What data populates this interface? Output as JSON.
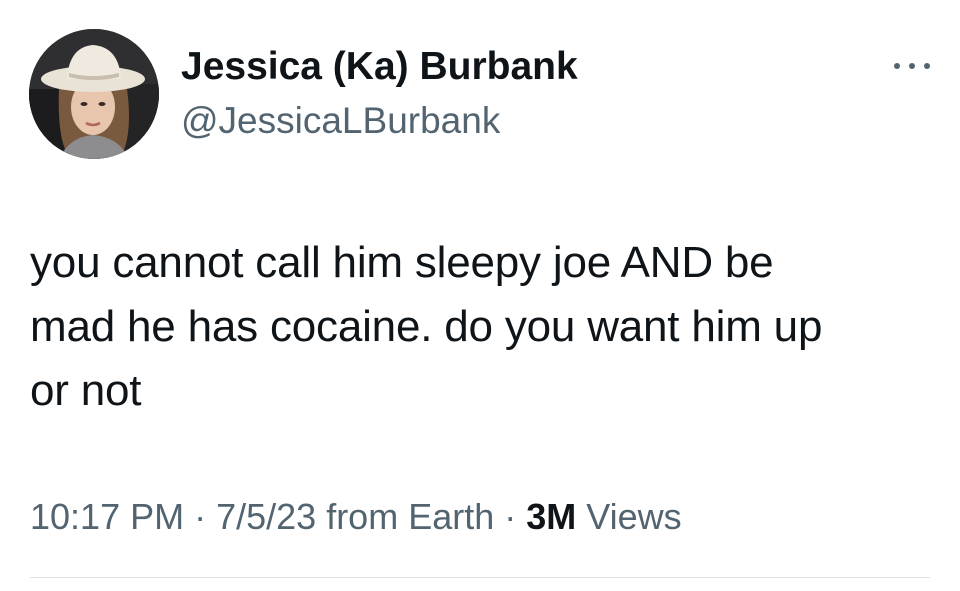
{
  "author": {
    "display_name": "Jessica (Ka) Burbank",
    "handle": "@JessicaLBurbank",
    "avatar_icon": "profile-photo-cowboy-hat"
  },
  "tweet": {
    "line1": "you cannot call him sleepy joe AND be",
    "line2": "mad he has cocaine. do you want him up",
    "line3": "or not"
  },
  "meta": {
    "time": "10:17 PM",
    "sep1": " · ",
    "date": "7/5/23",
    "source": " from Earth",
    "sep2": " · ",
    "views_count": "3M",
    "views_label": " Views"
  },
  "icons": {
    "more": "more-options-icon"
  },
  "colors": {
    "text_primary": "#0f1419",
    "text_secondary": "#536471",
    "divider": "#dfe3e6"
  }
}
